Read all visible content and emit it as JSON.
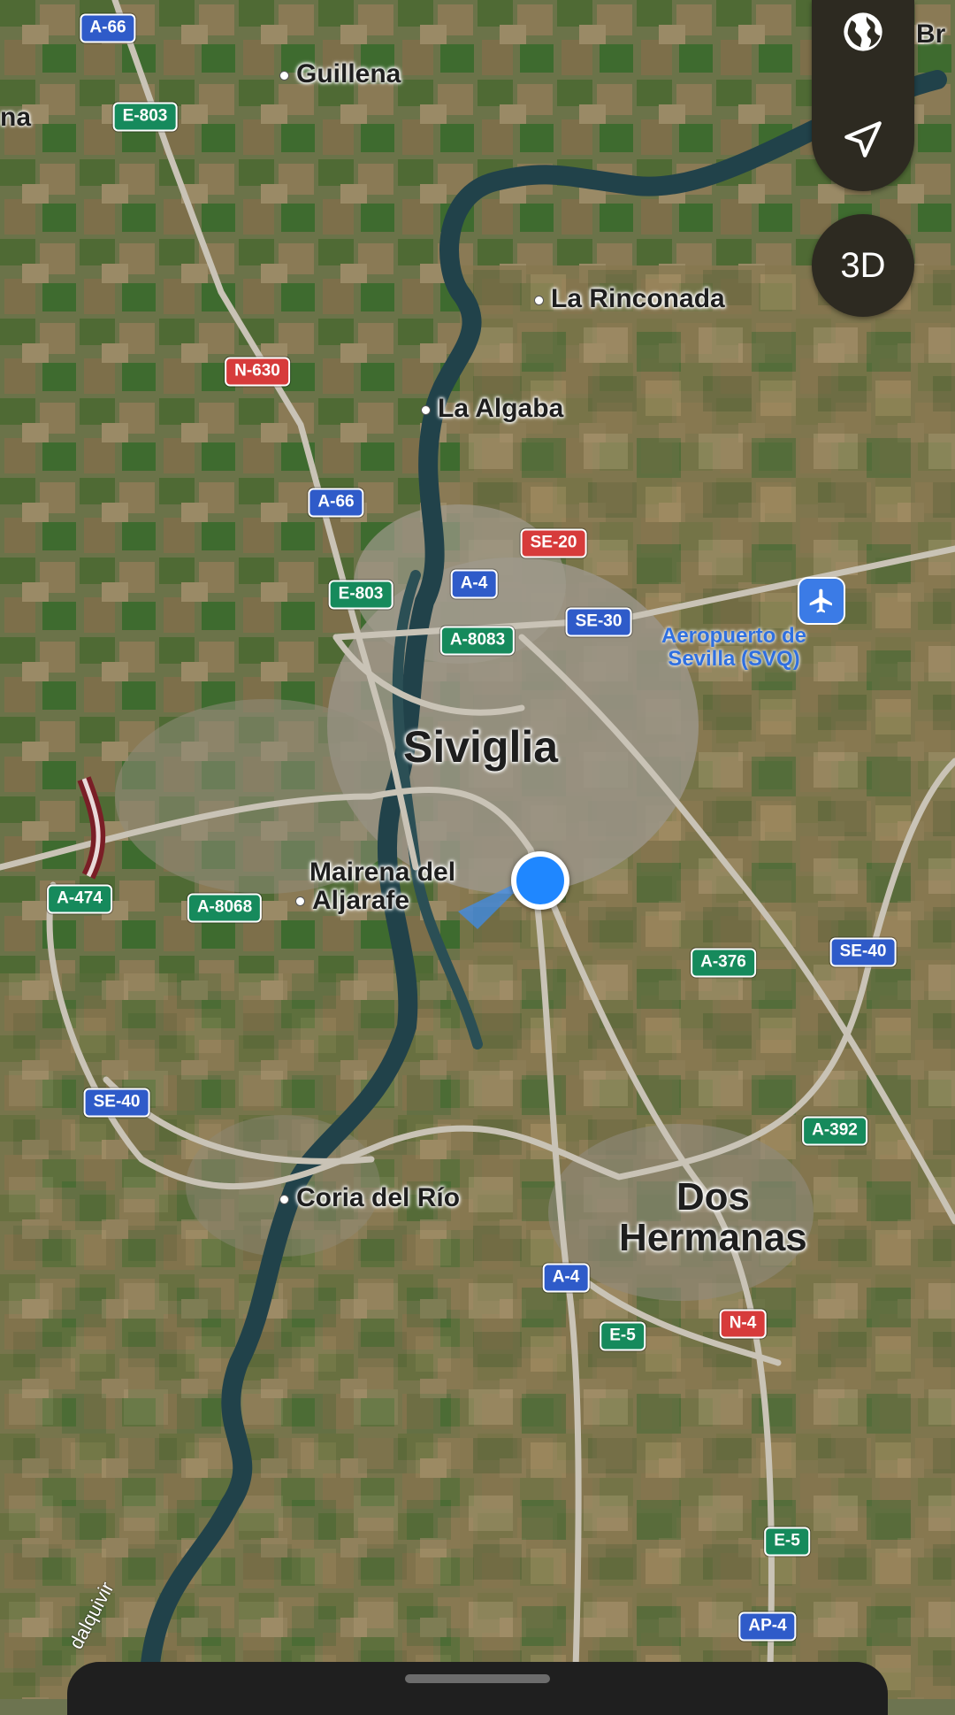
{
  "map": {
    "type": "satellite",
    "city": "Siviglia",
    "places": [
      {
        "id": "guillena",
        "label": "Guillena"
      },
      {
        "id": "la-rinconada",
        "label": "La Rinconada"
      },
      {
        "id": "la-algaba",
        "label": "La Algaba"
      },
      {
        "id": "mairena-line1",
        "label": "Mairena del"
      },
      {
        "id": "mairena-line2",
        "label": "Aljarafe"
      },
      {
        "id": "coria",
        "label": "Coria del Río"
      },
      {
        "id": "dos-hermanas-line1",
        "label": "Dos"
      },
      {
        "id": "dos-hermanas-line2",
        "label": "Hermanas"
      }
    ],
    "edge_labels": {
      "left": "na",
      "right": "Br"
    },
    "river_label": "dalquivir",
    "airport": {
      "line1": "Aeropuerto de",
      "line2": "Sevilla (SVQ)",
      "icon": "airplane-icon"
    },
    "roads": [
      {
        "id": "a66-top",
        "label": "A-66",
        "color": "blue"
      },
      {
        "id": "e803-top",
        "label": "E-803",
        "color": "green"
      },
      {
        "id": "n630",
        "label": "N-630",
        "color": "red"
      },
      {
        "id": "a66-mid",
        "label": "A-66",
        "color": "blue"
      },
      {
        "id": "e803-mid",
        "label": "E-803",
        "color": "green"
      },
      {
        "id": "se20",
        "label": "SE-20",
        "color": "red"
      },
      {
        "id": "a4-top",
        "label": "A-4",
        "color": "blue"
      },
      {
        "id": "a8083",
        "label": "A-8083",
        "color": "green"
      },
      {
        "id": "se30",
        "label": "SE-30",
        "color": "blue"
      },
      {
        "id": "a474",
        "label": "A-474",
        "color": "green"
      },
      {
        "id": "a8068",
        "label": "A-8068",
        "color": "green"
      },
      {
        "id": "a376",
        "label": "A-376",
        "color": "green"
      },
      {
        "id": "se40-right",
        "label": "SE-40",
        "color": "blue"
      },
      {
        "id": "se40-left",
        "label": "SE-40",
        "color": "blue"
      },
      {
        "id": "a392",
        "label": "A-392",
        "color": "green"
      },
      {
        "id": "a4-bottom",
        "label": "A-4",
        "color": "blue"
      },
      {
        "id": "n4",
        "label": "N-4",
        "color": "red"
      },
      {
        "id": "e5-a",
        "label": "E-5",
        "color": "green"
      },
      {
        "id": "e5-b",
        "label": "E-5",
        "color": "green"
      },
      {
        "id": "ap4",
        "label": "AP-4",
        "color": "blue"
      }
    ]
  },
  "controls": {
    "globe_icon": "globe-icon",
    "locate_icon": "location-arrow-icon",
    "three_d_label": "3D"
  },
  "colors": {
    "user_location": "#1f87ff",
    "river": "#21424a",
    "road": "#c9c3b6",
    "control_bg": "#2d2a21"
  }
}
